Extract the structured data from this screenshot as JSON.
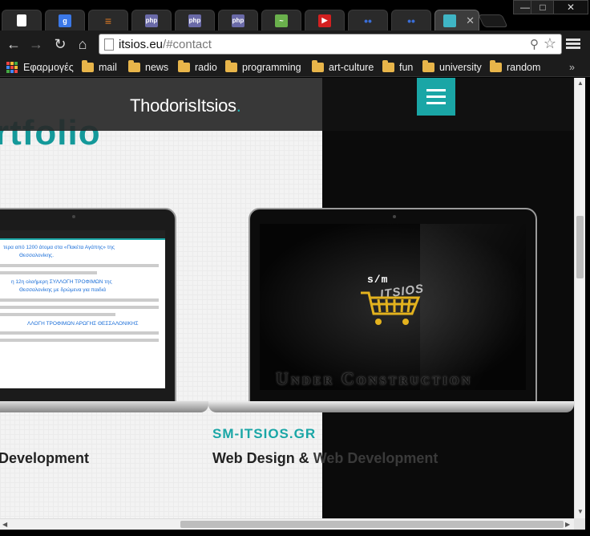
{
  "browser": {
    "url_host": "itsios.eu",
    "url_path": "/#contact",
    "tabs": [
      {
        "icon": "page-icon",
        "label": "",
        "color": "#ffffff"
      },
      {
        "icon": "google-icon",
        "label": "g",
        "color": "#3b78e7"
      },
      {
        "icon": "stackoverflow-icon",
        "label": "",
        "color": "#e07b24"
      },
      {
        "icon": "php-icon",
        "label": "php",
        "color": "#6a6aa8"
      },
      {
        "icon": "php-icon",
        "label": "php",
        "color": "#6a6aa8"
      },
      {
        "icon": "php-icon",
        "label": "php",
        "color": "#6a6aa8"
      },
      {
        "icon": "regex-icon",
        "label": "",
        "color": "#6ab04c"
      },
      {
        "icon": "youtube-icon",
        "label": "▶",
        "color": "#d32020"
      },
      {
        "icon": "eyes-icon",
        "label": "••",
        "color": "#3a6ed8"
      },
      {
        "icon": "eyes-icon",
        "label": "••",
        "color": "#3a6ed8"
      },
      {
        "icon": "site-icon",
        "label": "",
        "color": "#3fb5c5"
      }
    ],
    "bookmarks": [
      {
        "label": "Εφαρμογές",
        "type": "apps"
      },
      {
        "label": "mail",
        "type": "folder"
      },
      {
        "label": "news",
        "type": "folder"
      },
      {
        "label": "radio",
        "type": "folder"
      },
      {
        "label": "programming",
        "type": "folder"
      },
      {
        "label": "art-culture",
        "type": "folder"
      },
      {
        "label": "fun",
        "type": "folder"
      },
      {
        "label": "university",
        "type": "folder"
      },
      {
        "label": "random",
        "type": "folder"
      }
    ],
    "overflow": "»"
  },
  "site": {
    "logo_text": "ThodorisItsios",
    "logo_dot": ".",
    "heading": "rtfolio",
    "project1": {
      "caption": "Development"
    },
    "project2": {
      "name": "SM-ITSIOS.GR",
      "caption_a": "Web Design & ",
      "caption_b": "Web Development",
      "screen_sm": "s/m",
      "screen_brand": "ITSIOS",
      "screen_banner": "Under Construction"
    },
    "screen1_headlines": [
      "τερα από 1200 άτομα στα «Πακέτα Αγάπης» της",
      "Θεσσαλονίκης.",
      "η 12η ολοήμερη ΣΥΛΛΟΓΗ ΤΡΟΦΙΜΩΝ της",
      "Θεσσαλονίκης με δρώμενα για παιδιά",
      "ΛΛΟΓΗ ΤΡΟΦΙΜΩΝ ΑΡΩΓΗΣ ΘΕΣΣΑΛΟΝΙΚΗΣ"
    ]
  },
  "colors": {
    "accent": "#1aa6a6"
  }
}
